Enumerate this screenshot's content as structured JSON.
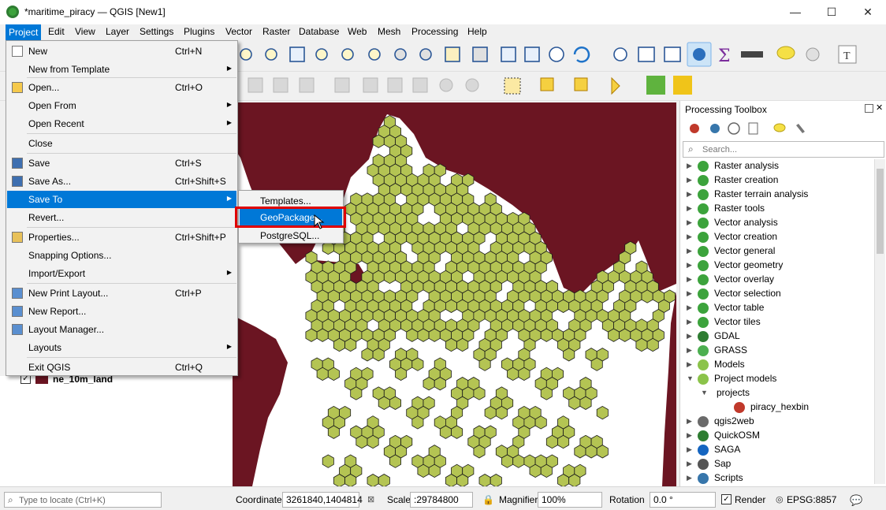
{
  "window": {
    "title": "*maritime_piracy — QGIS [New1]",
    "minimize": "—",
    "maximize": "☐",
    "close": "✕"
  },
  "menubar": [
    "Project",
    "Edit",
    "View",
    "Layer",
    "Settings",
    "Plugins",
    "Vector",
    "Raster",
    "Database",
    "Web",
    "Mesh",
    "Processing",
    "Help"
  ],
  "project_menu": {
    "items": [
      {
        "label": "New",
        "shortcut": "Ctrl+N"
      },
      {
        "label": "New from Template",
        "shortcut": "",
        "submenu": true
      },
      {
        "label": "Open...",
        "shortcut": "Ctrl+O"
      },
      {
        "label": "Open From",
        "shortcut": "",
        "submenu": true
      },
      {
        "label": "Open Recent",
        "shortcut": "",
        "submenu": true
      },
      {
        "label": "Close",
        "shortcut": ""
      },
      {
        "label": "Save",
        "shortcut": "Ctrl+S"
      },
      {
        "label": "Save As...",
        "shortcut": "Ctrl+Shift+S"
      },
      {
        "label": "Save To",
        "shortcut": "",
        "submenu": true
      },
      {
        "label": "Revert...",
        "shortcut": ""
      },
      {
        "label": "Properties...",
        "shortcut": "Ctrl+Shift+P"
      },
      {
        "label": "Snapping Options...",
        "shortcut": ""
      },
      {
        "label": "Import/Export",
        "shortcut": "",
        "submenu": true
      },
      {
        "label": "New Print Layout...",
        "shortcut": "Ctrl+P"
      },
      {
        "label": "New Report...",
        "shortcut": ""
      },
      {
        "label": "Layout Manager...",
        "shortcut": ""
      },
      {
        "label": "Layouts",
        "shortcut": "",
        "submenu": true
      },
      {
        "label": "Exit QGIS",
        "shortcut": "Ctrl+Q"
      }
    ],
    "submenu_arrow": "▶"
  },
  "save_to_submenu": [
    "Templates...",
    "GeoPackage...",
    "PostgreSQL..."
  ],
  "layers": {
    "item": "ne_10m_land",
    "checked": "✓"
  },
  "toolbox": {
    "title": "Processing Toolbox",
    "search_placeholder": "Search...",
    "items": [
      "Raster analysis",
      "Raster creation",
      "Raster terrain analysis",
      "Raster tools",
      "Vector analysis",
      "Vector creation",
      "Vector general",
      "Vector geometry",
      "Vector overlay",
      "Vector selection",
      "Vector table",
      "Vector tiles",
      "GDAL",
      "GRASS",
      "Models",
      "Project models"
    ],
    "projects_label": "projects",
    "model_label": "piracy_hexbin",
    "tail_items": [
      "qgis2web",
      "QuickOSM",
      "SAGA",
      "Sap",
      "Scripts"
    ],
    "collapsed_arrow": "▶",
    "expanded_arrow": "▼"
  },
  "statusbar": {
    "locate_placeholder": "Type to locate (Ctrl+K)",
    "coordinate_label": "Coordinate",
    "coordinate_value": "3261840,1404814",
    "scale_label": "Scale",
    "scale_value": ":29784800",
    "magnifier_label": "Magnifier",
    "magnifier_value": "100%",
    "rotation_label": "Rotation",
    "rotation_value": "0.0 °",
    "render_label": "Render",
    "crs": "EPSG:8857"
  },
  "colors": {
    "land": "#6b1522",
    "hex_fill": "#b4c453",
    "hex_stroke": "#1a1a1a",
    "highlight": "#0078d7",
    "annotation": "#e00000"
  }
}
